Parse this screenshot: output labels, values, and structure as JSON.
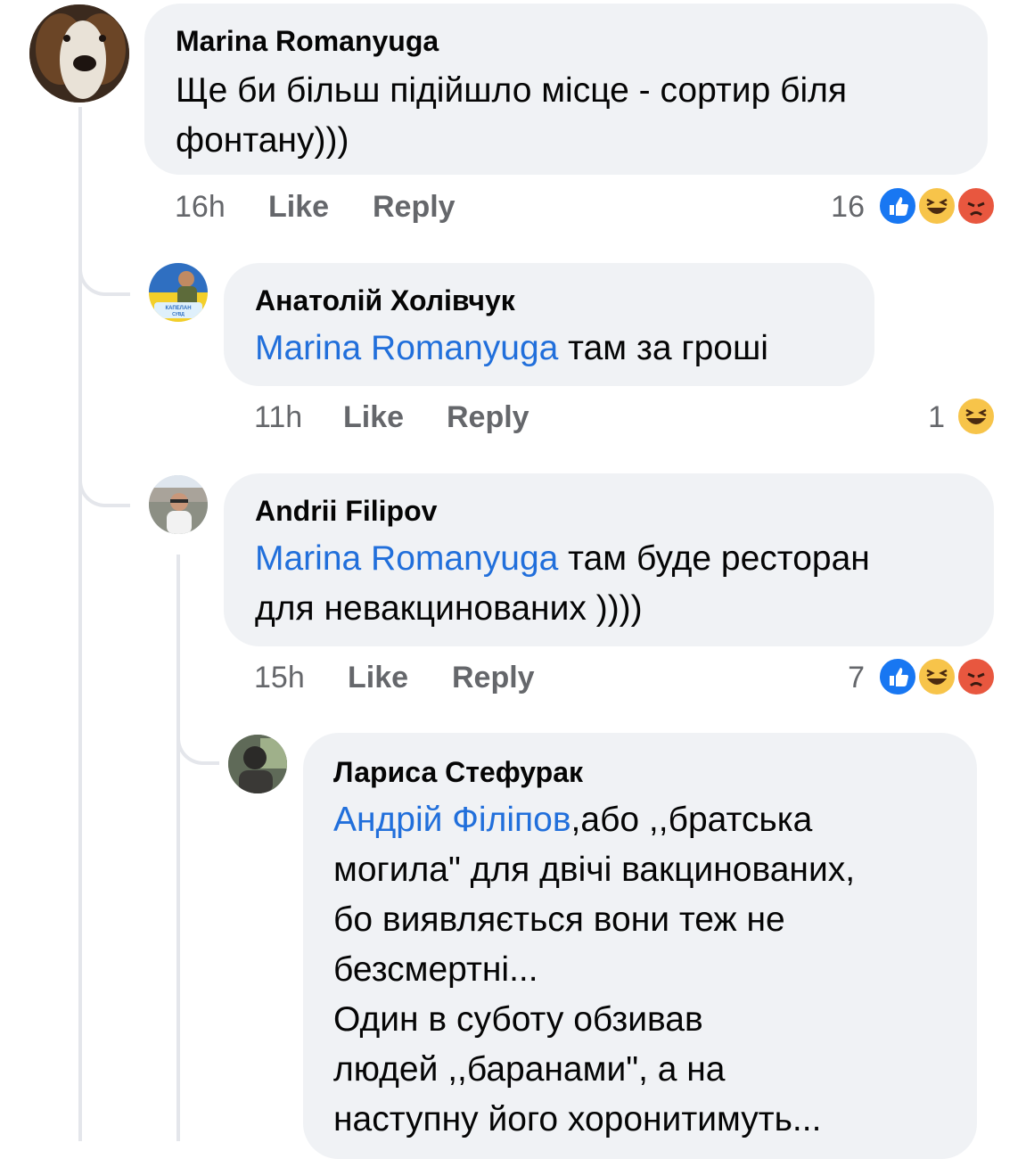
{
  "comments": [
    {
      "author": "Marina Romanyuga",
      "text_line1": "Ще би більш підійшло місце - сортир біля",
      "text_line2": "фонтану)))",
      "time": "16h",
      "like_label": "Like",
      "reply_label": "Reply",
      "reaction_count": "16",
      "reactions": [
        "like-icon",
        "haha-icon",
        "angry-icon"
      ]
    },
    {
      "author": "Анатолій Холівчук",
      "mention": "Marina Romanyuga",
      "text": " там за гроші",
      "avatar_label_line1": "КАПЕЛАН",
      "avatar_label_line2": "СУВД",
      "time": "11h",
      "like_label": "Like",
      "reply_label": "Reply",
      "reaction_count": "1",
      "reactions": [
        "haha-icon"
      ]
    },
    {
      "author": "Andrii Filipov",
      "mention": "Marina Romanyuga",
      "text_line1": " там буде ресторан",
      "text_line2": "для невакцинованих ))))",
      "time": "15h",
      "like_label": "Like",
      "reply_label": "Reply",
      "reaction_count": "7",
      "reactions": [
        "like-icon",
        "haha-icon",
        "angry-icon"
      ]
    },
    {
      "author": "Лариса Стефурак",
      "mention": "Андрій Філіпов",
      "text_line1": ",або ,,братська",
      "text_line2": "могила\" для двічі вакцинованих,",
      "text_line3": "бо виявляється вони теж не",
      "text_line4": "безсмертні...",
      "text_line5": "Один в суботу обзивав",
      "text_line6": "людей ,,баранами\",  а на",
      "text_line7": "наступну його хоронитимуть..."
    }
  ],
  "colors": {
    "bubble": "#f0f2f5",
    "mention": "#216fdb",
    "meta": "#65676b",
    "like": "#1877f2",
    "haha": "#f7c44a",
    "angry": "#e8573f"
  }
}
